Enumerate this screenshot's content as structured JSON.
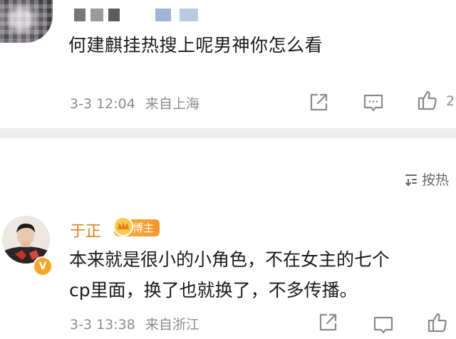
{
  "post1": {
    "comment": "何建麒挂热搜上呢男神你怎么看",
    "time": "3-3 12:04",
    "location": "来自上海",
    "like_count_partial": "2"
  },
  "sort": {
    "label": "按热"
  },
  "post2": {
    "username": "于正",
    "badge": "博主",
    "comment_line1": "本来就是很小的小角色，不在女主的七个",
    "comment_line2": "cp里面，换了也就换了，不多传播。",
    "time": "3-3 13:38",
    "location": "来自浙江"
  },
  "colors": {
    "username": "#e8811a",
    "badge": "#f3962a",
    "meta": "#8c8c8c",
    "divider": "#eeeeee"
  },
  "icons": [
    "share-icon",
    "comment-icon",
    "like-icon",
    "sort-icon",
    "crown-icon",
    "verified-icon"
  ]
}
